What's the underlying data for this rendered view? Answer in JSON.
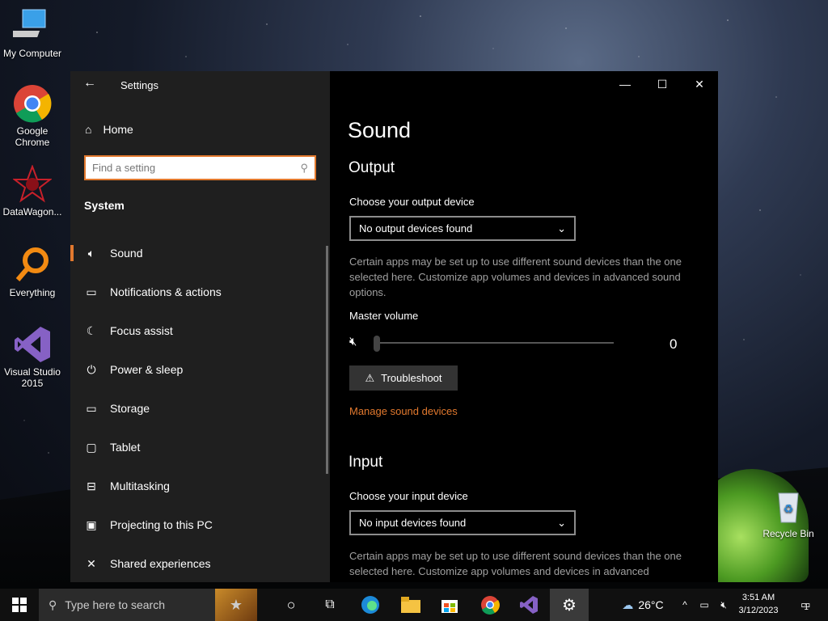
{
  "desktop": {
    "icons": [
      {
        "label": "My Computer"
      },
      {
        "label": "Google Chrome"
      },
      {
        "label": "DataWagon..."
      },
      {
        "label": "Everything"
      },
      {
        "label": "Visual Studio 2015"
      },
      {
        "label": "Recycle Bin"
      }
    ]
  },
  "settings": {
    "title": "Settings",
    "home_label": "Home",
    "search_placeholder": "Find a setting",
    "category": "System",
    "nav": [
      {
        "label": "Sound",
        "icon": "speaker-icon"
      },
      {
        "label": "Notifications & actions",
        "icon": "notification-icon"
      },
      {
        "label": "Focus assist",
        "icon": "moon-icon"
      },
      {
        "label": "Power & sleep",
        "icon": "power-icon"
      },
      {
        "label": "Storage",
        "icon": "storage-icon"
      },
      {
        "label": "Tablet",
        "icon": "tablet-icon"
      },
      {
        "label": "Multitasking",
        "icon": "multitasking-icon"
      },
      {
        "label": "Projecting to this PC",
        "icon": "projecting-icon"
      },
      {
        "label": "Shared experiences",
        "icon": "shared-icon"
      }
    ],
    "main": {
      "title": "Sound",
      "output": {
        "heading": "Output",
        "device_label": "Choose your output device",
        "device_value": "No output devices found",
        "description": "Certain apps may be set up to use different sound devices than the one selected here. Customize app volumes and devices in advanced sound options.",
        "volume_label": "Master volume",
        "volume_value": "0",
        "troubleshoot_label": "Troubleshoot",
        "manage_link": "Manage sound devices"
      },
      "input": {
        "heading": "Input",
        "device_label": "Choose your input device",
        "device_value": "No input devices found",
        "description": "Certain apps may be set up to use different sound devices than the one selected here. Customize app volumes and devices in advanced"
      }
    }
  },
  "taskbar": {
    "search_placeholder": "Type here to search",
    "weather_temp": "26°C",
    "time": "3:51 AM",
    "date": "3/12/2023",
    "notification_count": "1"
  },
  "colors": {
    "accent": "#e2792e",
    "sidebar_bg": "#1f1f1f",
    "main_bg": "#000000",
    "taskbar_bg": "#101010"
  }
}
